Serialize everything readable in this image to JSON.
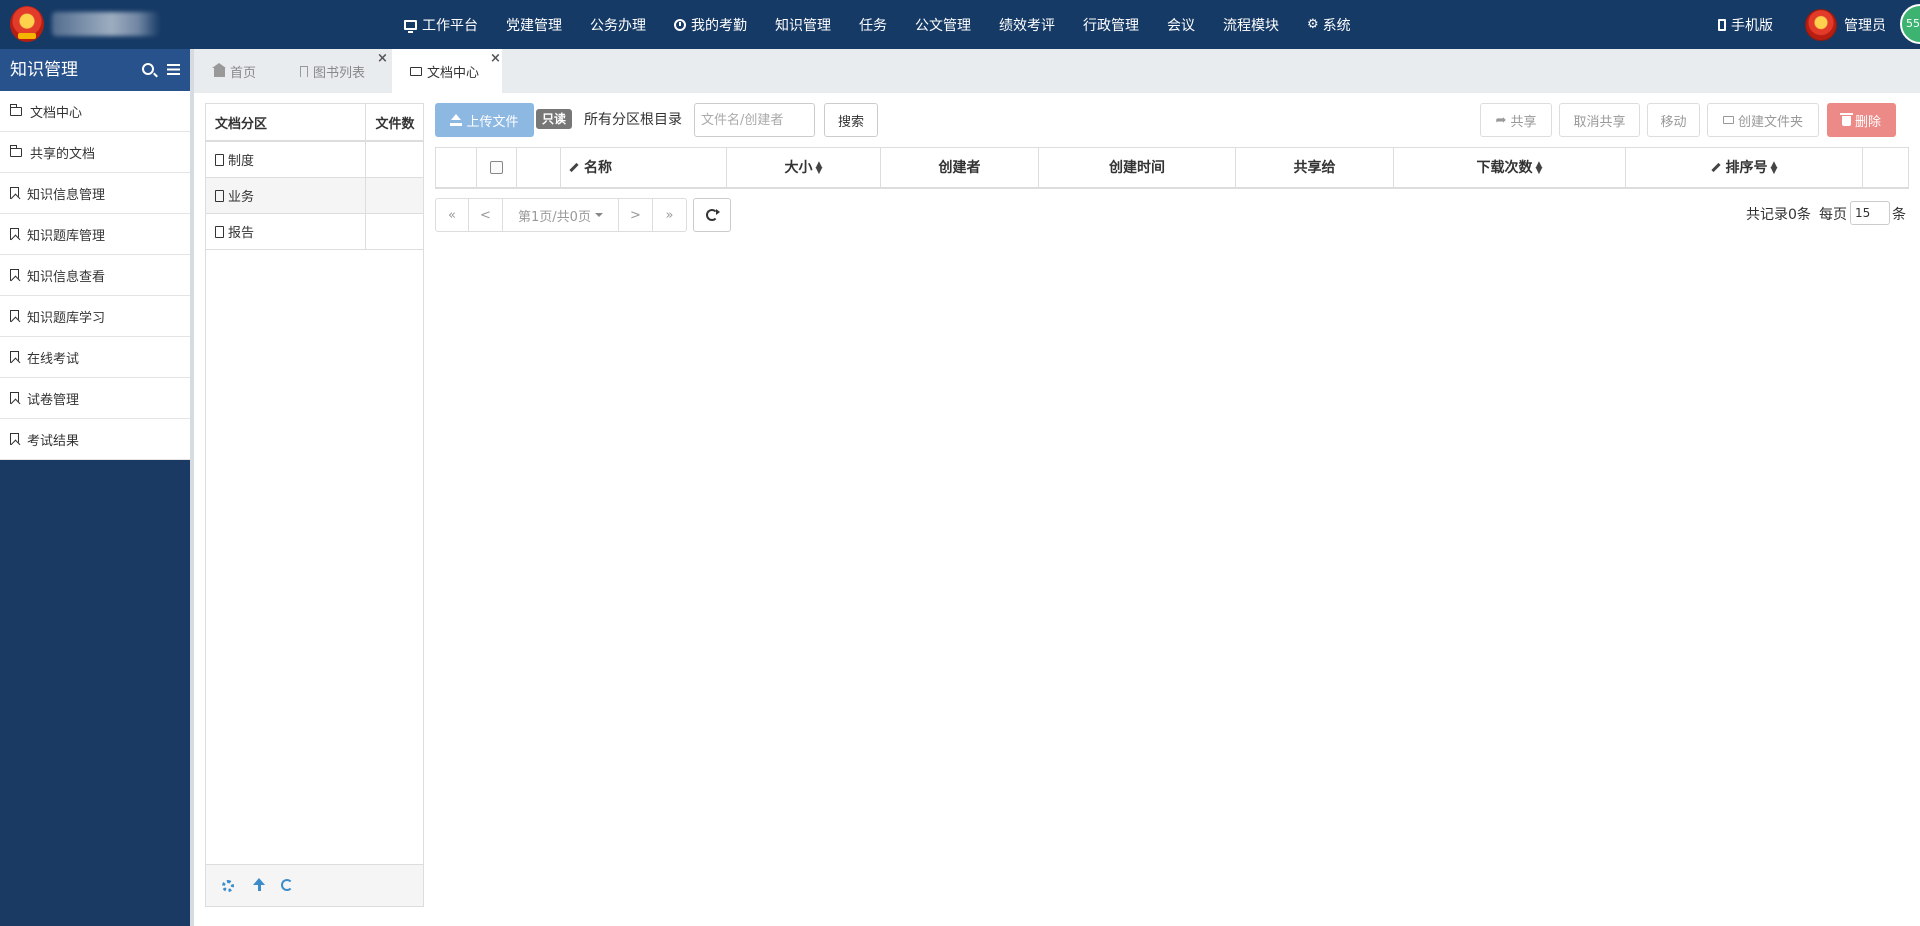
{
  "nav": {
    "items": [
      {
        "label": "工作平台",
        "icon": "monitor-icon"
      },
      {
        "label": "党建管理"
      },
      {
        "label": "公务办理"
      },
      {
        "label": "我的考勤",
        "icon": "clock-icon"
      },
      {
        "label": "知识管理"
      },
      {
        "label": "任务"
      },
      {
        "label": "公文管理"
      },
      {
        "label": "绩效考评"
      },
      {
        "label": "行政管理"
      },
      {
        "label": "会议"
      },
      {
        "label": "流程模块"
      },
      {
        "label": "系统",
        "icon": "gear-icon"
      }
    ],
    "mobile": "手机版",
    "user": "管理员",
    "badge": "55"
  },
  "sidebar": {
    "title": "知识管理",
    "items": [
      {
        "label": "文档中心",
        "icon": "folder-icon"
      },
      {
        "label": "共享的文档",
        "icon": "folder-open-icon"
      },
      {
        "label": "知识信息管理",
        "icon": "bookmark-icon"
      },
      {
        "label": "知识题库管理",
        "icon": "bookmark-icon"
      },
      {
        "label": "知识信息查看",
        "icon": "bookmark-icon"
      },
      {
        "label": "知识题库学习",
        "icon": "bookmark-icon"
      },
      {
        "label": "在线考试",
        "icon": "bookmark-icon"
      },
      {
        "label": "试卷管理",
        "icon": "bookmark-icon"
      },
      {
        "label": "考试结果",
        "icon": "bookmark-icon"
      }
    ]
  },
  "tabs": [
    {
      "label": "首页",
      "icon": "home-icon"
    },
    {
      "label": "图书列表",
      "icon": "bookmark-icon"
    },
    {
      "label": "文档中心",
      "icon": "folder-icon",
      "active": true
    }
  ],
  "partition": {
    "col_name": "文档分区",
    "col_count": "文件数",
    "rows": [
      {
        "name": "制度",
        "count": ""
      },
      {
        "name": "业务",
        "count": ""
      },
      {
        "name": "报告",
        "count": ""
      }
    ]
  },
  "toolbar": {
    "upload": "上传文件",
    "readonly": "只读",
    "root_dir": "所有分区根目录",
    "search_placeholder": "文件名/创建者",
    "search": "搜索",
    "share": "共享",
    "unshare": "取消共享",
    "move": "移动",
    "new_folder": "创建文件夹",
    "delete": "删除"
  },
  "table": {
    "columns": [
      "名称",
      "大小",
      "创建者",
      "创建时间",
      "共享给",
      "下载次数",
      "排序号"
    ]
  },
  "pager": {
    "first": "«",
    "prev": "<",
    "page_info": "第1页/共0页",
    "next": ">",
    "last": "»",
    "total": "共记录0条",
    "per_page_label": "每页",
    "per_page": "15",
    "per_page_unit": "条"
  },
  "colors": {
    "topbar": "#163a66",
    "sidebar_head": "#28528b",
    "upload_btn": "#8db8e2",
    "delete_btn": "#ec8a87",
    "badge": "#3cb371"
  }
}
